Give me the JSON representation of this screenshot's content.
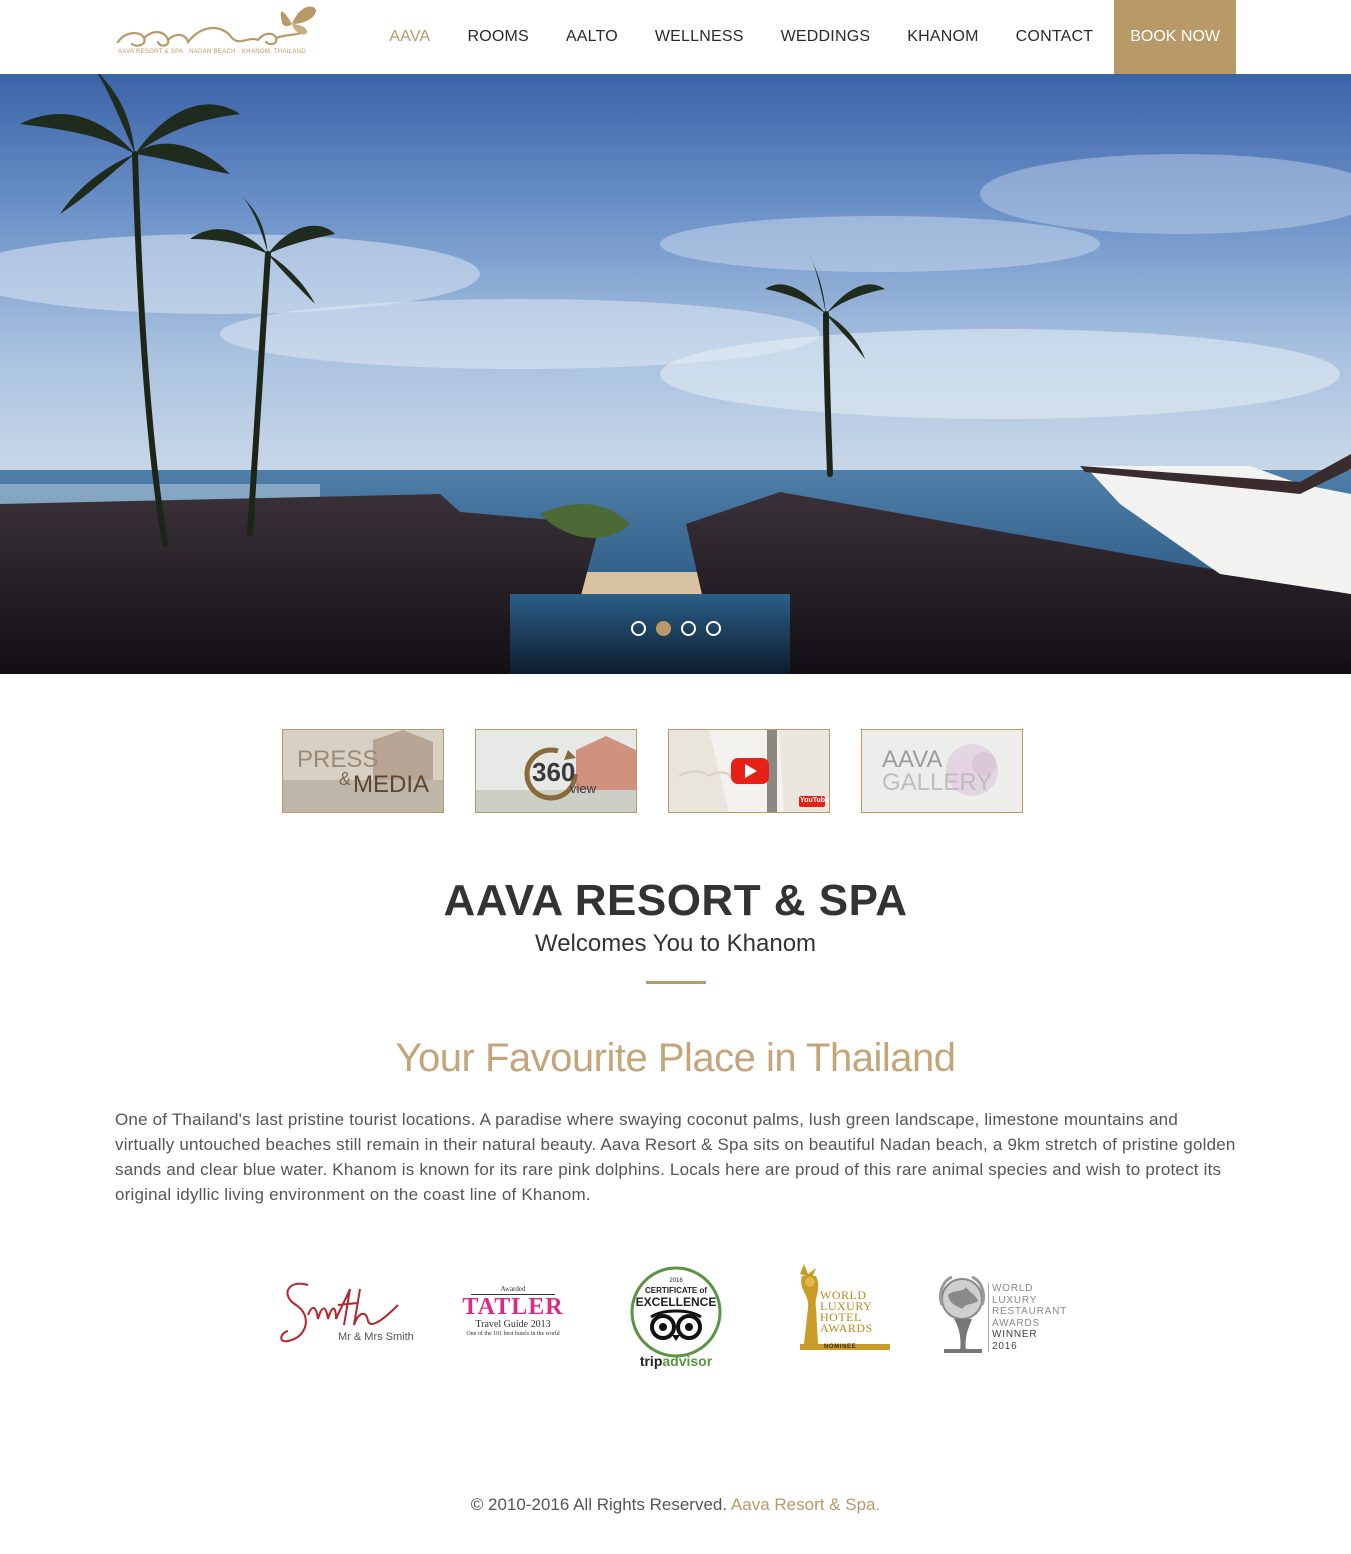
{
  "logo": {
    "brand": "aava",
    "tagline": "AAVA RESORT & SPA · NADAN BEACH · KHANOM, THAILAND",
    "icon": "butterfly-icon"
  },
  "nav": {
    "items": [
      "AAVA",
      "ROOMS",
      "AALTO",
      "WELLNESS",
      "WEDDINGS",
      "KHANOM",
      "CONTACT"
    ],
    "active": "AAVA",
    "book_now": "BOOK NOW"
  },
  "slider": {
    "slide_count": 4,
    "active_slide": 2
  },
  "tiles": {
    "press_line1": "PRESS",
    "press_amp": "&",
    "press_line2": "MEDIA",
    "view_number": "360",
    "view_word": "view",
    "youtube_badge": "YouTube",
    "gallery_line1": "AAVA",
    "gallery_line2": "GALLERY"
  },
  "hero_text": {
    "title": "AAVA RESORT & SPA",
    "subtitle": "Welcomes You to Khanom",
    "tagline": "Your Favourite Place in Thailand",
    "intro": "One of Thailand's last pristine tourist locations. A paradise where swaying coconut palms, lush green landscape, limestone mountains and virtually untouched beaches still remain in their natural beauty. Aava Resort & Spa sits on beautiful Nadan beach, a 9km stretch of pristine golden sands and clear blue water. Khanom is known for its rare pink dolphins. Locals here are proud of this rare animal species and wish to protect its original idyllic living environment on the coast line of Khanom."
  },
  "awards": {
    "smith_script": "Smith",
    "smith_caption": "Mr & Mrs Smith",
    "tatler_top": "Awarded",
    "tatler_name": "TATLER",
    "tatler_guide": "Travel Guide 2013",
    "tatler_caption": "One of the 101 best hotels in the world",
    "ta_year": "2016",
    "ta_cert": "CERTIFICATE of",
    "ta_excellence": "EXCELLENCE",
    "ta_brand_trip": "trip",
    "ta_brand_advisor": "advisor",
    "wlh_1": "WORLD",
    "wlh_2": "LUXURY",
    "wlh_3": "HOTEL",
    "wlh_4": "AWARDS",
    "wlh_5": "NOMINEE",
    "wlr_1": "WORLD",
    "wlr_2": "LUXURY",
    "wlr_3": "RESTAURANT",
    "wlr_4": "AWARDS",
    "wlr_5": "WINNER",
    "wlr_6": "2016"
  },
  "footer": {
    "copyright": "© 2010-2016 All Rights Reserved.",
    "brand_link": "Aava Resort & Spa."
  },
  "colors": {
    "accent": "#b89968",
    "text": "#333333",
    "body_text": "#555555"
  }
}
